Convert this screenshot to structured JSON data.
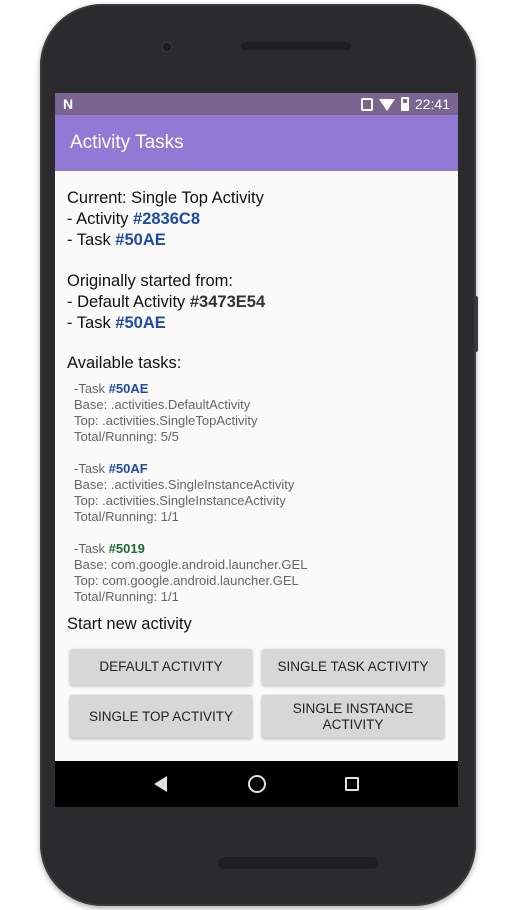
{
  "status_bar": {
    "notification_icon": "N",
    "time": "22:41"
  },
  "app_bar": {
    "title": "Activity Tasks"
  },
  "current": {
    "label": "Current: Single Top Activity",
    "activity_prefix": "- Activity ",
    "activity_hash": "#2836C8",
    "task_prefix": "- Task ",
    "task_hash": "#50AE"
  },
  "origin": {
    "label": "Originally started from:",
    "activity_prefix": "- Default Activity ",
    "activity_hash": "#3473E54",
    "task_prefix": "- Task ",
    "task_hash": "#50AE"
  },
  "tasks": {
    "title": "Available tasks:",
    "items": [
      {
        "prefix": "-Task ",
        "hash": "#50AE",
        "base": "Base: .activities.DefaultActivity",
        "top": "Top: .activities.SingleTopActivity",
        "running": "Total/Running: 5/5"
      },
      {
        "prefix": "-Task ",
        "hash": "#50AF",
        "base": "Base: .activities.SingleInstanceActivity",
        "top": "Top: .activities.SingleInstanceActivity",
        "running": "Total/Running: 1/1"
      },
      {
        "prefix": "-Task ",
        "hash": "#5019",
        "base": "Base: com.google.android.launcher.GEL",
        "top": "Top: com.google.android.launcher.GEL",
        "running": "Total/Running: 1/1"
      }
    ]
  },
  "start": {
    "title": "Start new activity",
    "buttons": {
      "default": "Default Activity",
      "single_task": "Single Task Activity",
      "single_top": "Single Top Activity",
      "single_instance": "Single Instance Activity"
    }
  },
  "colors": {
    "app_bar": "#9279d6",
    "status_bar": "#7c6490",
    "hash_blue": "#1f4aa6",
    "hash_green": "#1d6b32"
  },
  "icons": {
    "nav": [
      "back-icon",
      "home-icon",
      "recents-icon"
    ]
  }
}
